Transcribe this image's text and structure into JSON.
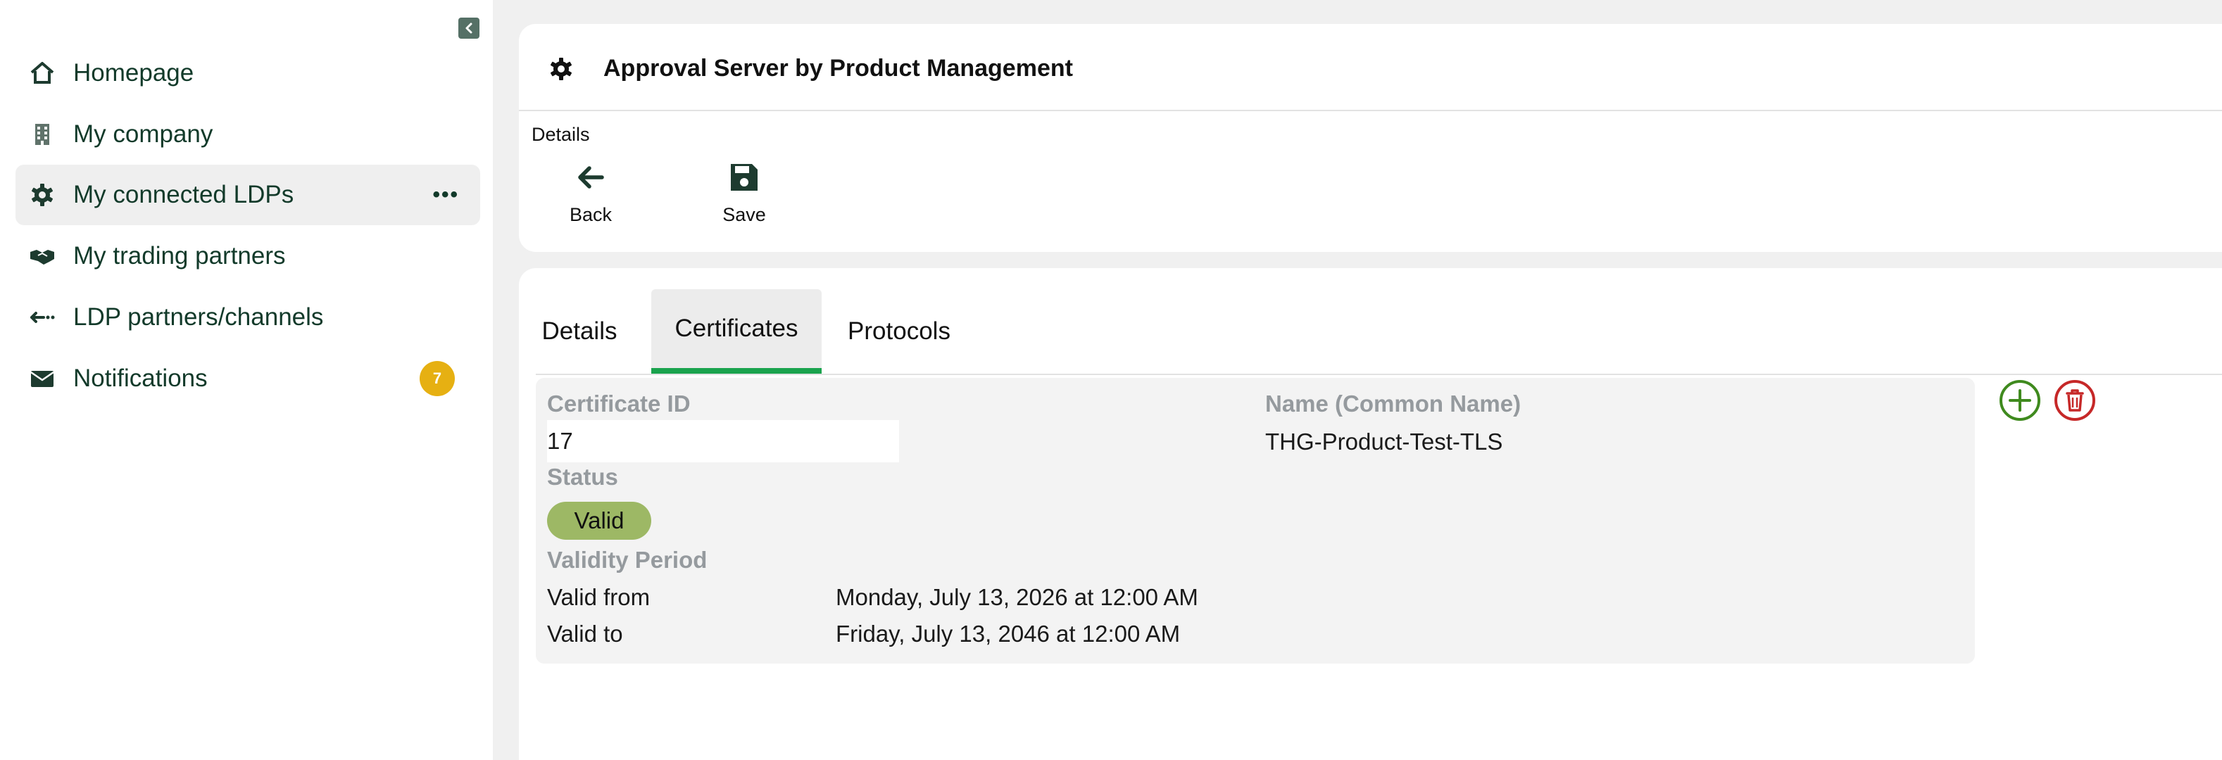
{
  "sidebar": {
    "items": [
      {
        "label": "Homepage",
        "icon": "home-icon"
      },
      {
        "label": "My company",
        "icon": "building-icon"
      },
      {
        "label": "My connected LDPs",
        "icon": "gear-icon",
        "more": "•••"
      },
      {
        "label": "My trading partners",
        "icon": "handshake-icon"
      },
      {
        "label": "LDP partners/channels",
        "icon": "arrows-icon"
      },
      {
        "label": "Notifications",
        "icon": "envelope-icon",
        "badge": "7"
      }
    ]
  },
  "header": {
    "title": "Approval Server by Product Management",
    "section_label": "Details",
    "back_label": "Back",
    "save_label": "Save"
  },
  "tabs": [
    {
      "label": "Details"
    },
    {
      "label": "Certificates"
    },
    {
      "label": "Protocols"
    }
  ],
  "certificate": {
    "id_label": "Certificate ID",
    "id_value": "17",
    "name_label": "Name (Common Name)",
    "name_value": "THG-Product-Test-TLS",
    "status_label": "Status",
    "status_value": "Valid",
    "validity_label": "Validity Period",
    "valid_from_label": "Valid from",
    "valid_from_value": "Monday, July 13, 2026 at 12:00 AM",
    "valid_to_label": "Valid to",
    "valid_to_value": "Friday, July 13, 2046 at 12:00 AM"
  },
  "colors": {
    "accent_green": "#1aa34e",
    "status_valid": "#9db865",
    "badge": "#e6b012",
    "delete_red": "#c62828",
    "add_green": "#3f8a1e"
  }
}
